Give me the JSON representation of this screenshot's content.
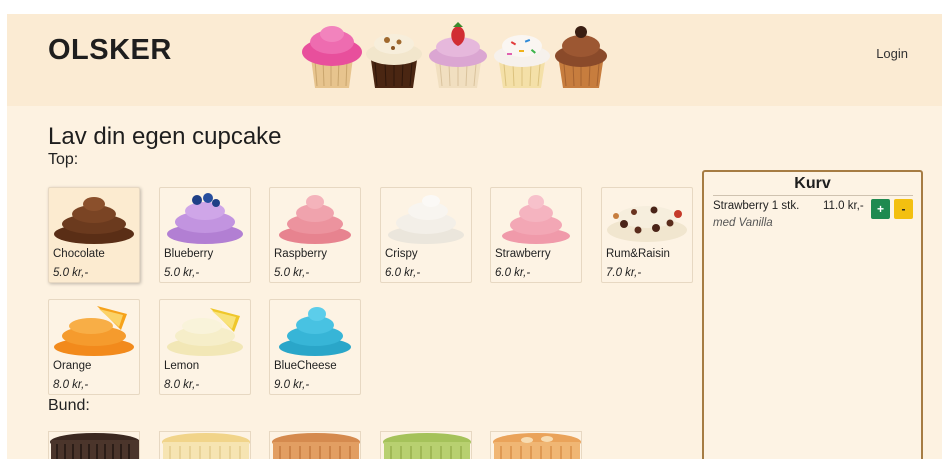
{
  "header": {
    "brand": "OLSKER",
    "login_label": "Login"
  },
  "main": {
    "title": "Lav din egen cupcake",
    "top_label": "Top:",
    "bottom_label": "Bund:"
  },
  "toppings": [
    {
      "name": "Chocolate",
      "price": "5.0 kr,-"
    },
    {
      "name": "Blueberry",
      "price": "5.0 kr,-"
    },
    {
      "name": "Raspberry",
      "price": "5.0 kr,-"
    },
    {
      "name": "Crispy",
      "price": "6.0 kr,-"
    },
    {
      "name": "Strawberry",
      "price": "6.0 kr,-"
    },
    {
      "name": "Rum&Raisin",
      "price": "7.0 kr,-"
    },
    {
      "name": "Orange",
      "price": "8.0 kr,-"
    },
    {
      "name": "Lemon",
      "price": "8.0 kr,-"
    },
    {
      "name": "BlueCheese",
      "price": "9.0 kr,-"
    }
  ],
  "basket": {
    "title": "Kurv",
    "items": [
      {
        "name": "Strawberry 1 stk.",
        "bottom": "med Vanilla",
        "price": "11.0 kr,-",
        "plus_label": "+",
        "minus_label": "-"
      }
    ]
  },
  "colors": {
    "header_bg": "#fbebd3",
    "page_bg": "#fdf2e1",
    "basket_border": "#a67c43",
    "plus_button": "#1e8a50",
    "minus_button": "#f3c010"
  }
}
